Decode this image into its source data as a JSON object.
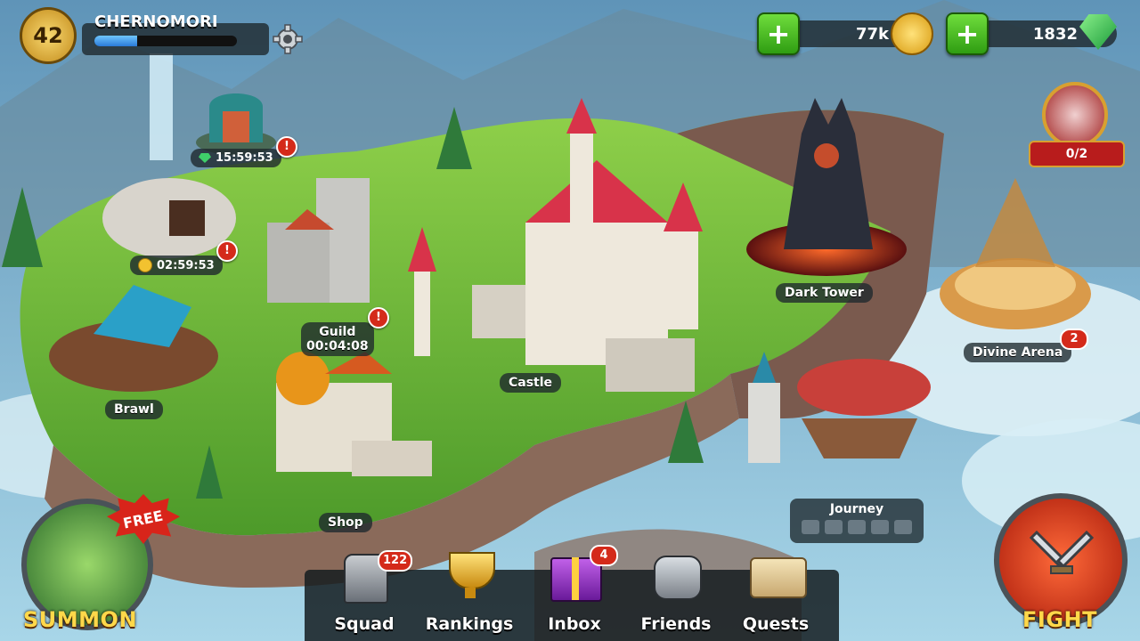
{
  "player": {
    "level": "42",
    "name": "CHERNOMORI",
    "xp_progress": 0.3
  },
  "settings": {
    "icon": "gear-icon"
  },
  "currencies": {
    "coins": "77k",
    "gems": "1832"
  },
  "boss_event": {
    "progress": "0/2"
  },
  "map": {
    "portal": {
      "timer": "15:59:53"
    },
    "mine": {
      "timer": "02:59:53"
    },
    "guild": {
      "name": "Guild",
      "timer": "00:04:08"
    },
    "brawl": {
      "name": "Brawl"
    },
    "castle": {
      "name": "Castle"
    },
    "dark_tower": {
      "name": "Dark Tower"
    },
    "divine_arena": {
      "name": "Divine Arena",
      "badge": "2"
    },
    "shop": {
      "name": "Shop"
    },
    "journey": {
      "name": "Journey"
    }
  },
  "alerts": {
    "mark": "!"
  },
  "summon": {
    "label": "SUMMON",
    "free_label": "FREE"
  },
  "fight": {
    "label": "FIGHT"
  },
  "nav": {
    "squad": {
      "label": "Squad",
      "badge": "122"
    },
    "rankings": {
      "label": "Rankings"
    },
    "inbox": {
      "label": "Inbox",
      "badge": "4"
    },
    "friends": {
      "label": "Friends"
    },
    "quests": {
      "label": "Quests"
    }
  },
  "colors": {
    "grass": "#6fbf3a",
    "sky": "#7fb6d6",
    "cliff": "#8a6a5a",
    "accent_gold": "#f2c230",
    "alert_red": "#d42a1a"
  }
}
